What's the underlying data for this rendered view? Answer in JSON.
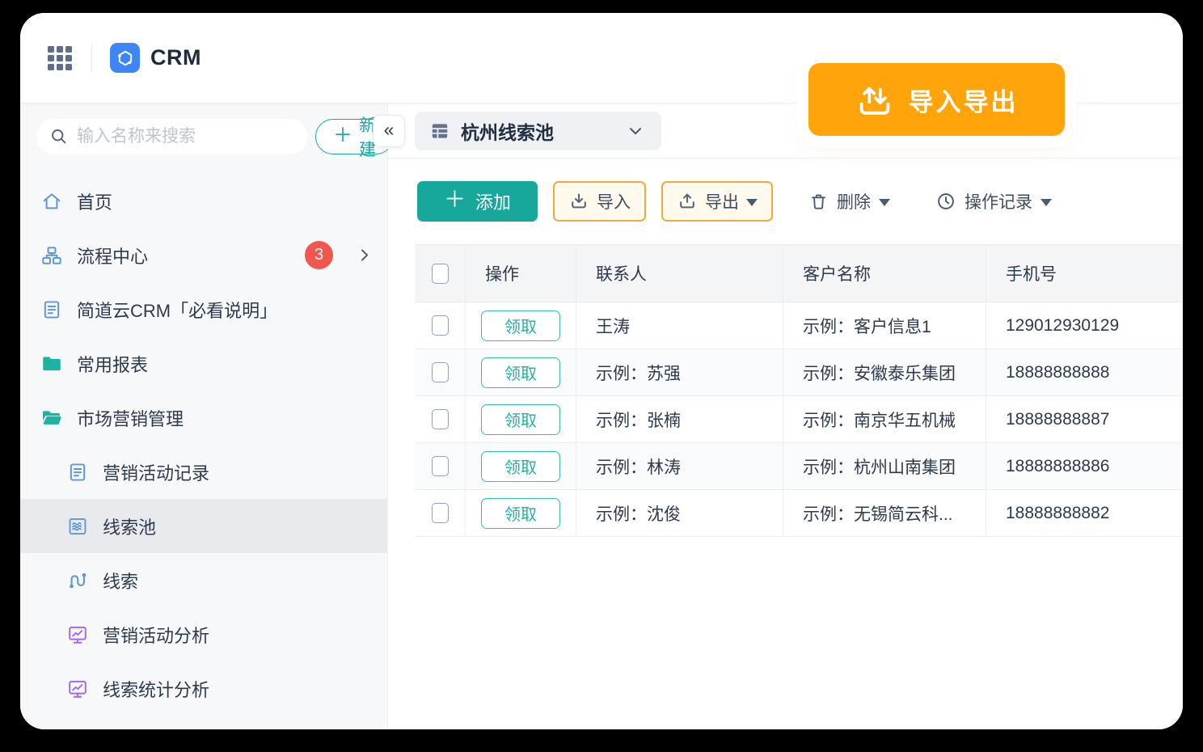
{
  "topbar": {
    "app_name": "CRM"
  },
  "overlay_button": {
    "label": "导入导出",
    "icon": "import-export-icon"
  },
  "sidebar": {
    "search": {
      "placeholder": "输入名称来搜索",
      "icon": "search-icon"
    },
    "new_button": {
      "label": "新建",
      "plus": "＋",
      "icon": "plus-icon"
    },
    "items": [
      {
        "label": "首页",
        "icon": "home-icon"
      },
      {
        "label": "流程中心",
        "icon": "workflow-icon",
        "badge": "3",
        "has_submenu": true
      },
      {
        "label": "简道云CRM「必看说明」",
        "icon": "document-icon"
      },
      {
        "label": "常用报表",
        "icon": "folder-icon"
      },
      {
        "label": "市场营销管理",
        "icon": "folder-open-icon"
      },
      {
        "label": "营销活动记录",
        "icon": "document-icon",
        "indent": 1
      },
      {
        "label": "线索池",
        "icon": "lead-pool-icon",
        "indent": 1,
        "selected": true
      },
      {
        "label": "线索",
        "icon": "lead-icon",
        "indent": 1
      },
      {
        "label": "营销活动分析",
        "icon": "chart-monitor-icon",
        "indent": 1
      },
      {
        "label": "线索统计分析",
        "icon": "chart-monitor-icon",
        "indent": 1
      }
    ]
  },
  "main": {
    "collapse_button": "«",
    "view_switcher": {
      "title": "杭州线索池",
      "icon": "table-view-icon"
    },
    "toolbar": {
      "add_label": "添加",
      "import_label": "导入",
      "export_label": "导出",
      "delete_label": "删除",
      "history_label": "操作记录"
    },
    "table": {
      "claim_button_label": "领取",
      "columns": [
        "操作",
        "联系人",
        "客户名称",
        "手机号"
      ],
      "rows": [
        {
          "contact": "王涛",
          "customer": "示例：客户信息1",
          "phone": "129012930129"
        },
        {
          "contact": "示例：苏强",
          "customer": "示例：安徽泰乐集团",
          "phone": "18888888888"
        },
        {
          "contact": "示例：张楠",
          "customer": "示例：南京华五机械",
          "phone": "18888888887"
        },
        {
          "contact": "示例：林涛",
          "customer": "示例：杭州山南集团",
          "phone": "18888888886"
        },
        {
          "contact": "示例：沈俊",
          "customer": "示例：无锡简云科...",
          "phone": "18888888882"
        }
      ]
    }
  },
  "colors": {
    "brand_teal": "#17A79B",
    "claim_teal": "#2EC0B0",
    "accent_orange": "#FFA40B",
    "outline_button_orange": "#F5A83C",
    "outline_button_bg": "#FFFAEC",
    "icon_blue": "#5E97D8",
    "icon_teal_folder": "#1CB3A0",
    "icon_purple": "#A06BEC",
    "badge_red": "#F1564F",
    "logo_blue": "#3E86F8",
    "text_dark": "#2C3A4D",
    "sidebar_bg": "#F7F8FA",
    "selected_item_bg": "#E8EAEE",
    "table_header_bg": "#F4F5F7"
  }
}
